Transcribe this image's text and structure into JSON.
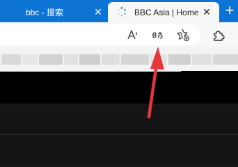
{
  "tabs": [
    {
      "label": "bbc - 搜索",
      "active": false,
      "close_glyph": "✕"
    },
    {
      "label": "BBC Asia | Home",
      "active": true,
      "close_glyph": "✕"
    }
  ],
  "new_tab_glyph": "+",
  "toolbar": {
    "icons": [
      "read-aloud-icon",
      "translate-icon",
      "add-favorite-icon",
      "extensions-icon"
    ]
  },
  "colors": {
    "tabstrip": "#0d74d6",
    "toolbar": "#f7f7f7",
    "page_background": "#000000",
    "annotation_arrow": "#e5363c"
  }
}
